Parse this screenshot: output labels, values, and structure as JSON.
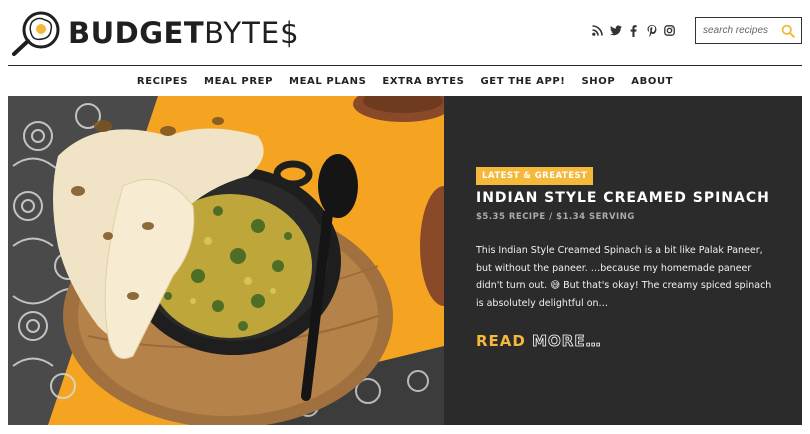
{
  "brand": {
    "logo_bold": "BUDGET",
    "logo_thin": "BYTE$"
  },
  "social_icons": [
    "rss-icon",
    "twitter-icon",
    "facebook-icon",
    "pinterest-icon",
    "instagram-icon"
  ],
  "search": {
    "placeholder": "search recipes"
  },
  "nav": {
    "items": [
      "RECIPES",
      "MEAL PREP",
      "MEAL PLANS",
      "EXTRA BYTES",
      "GET THE APP!",
      "SHOP",
      "ABOUT"
    ]
  },
  "feature": {
    "badge": "LATEST & GREATEST",
    "title": "INDIAN STYLE CREAMED SPINACH",
    "cost": "$5.35 RECIPE / $1.34 SERVING",
    "description": "This Indian Style Creamed Spinach is a bit like Palak Paneer, but without the paneer. …because my homemade paneer didn't turn out. 😅 But that's okay! The creamy spiced spinach is absolutely delightful on…",
    "read_more_1": "READ",
    "read_more_2": "MORE…",
    "image_alt": "Indian style creamed spinach in black bowl with naan bread"
  },
  "colors": {
    "accent": "#f4b93a",
    "panel": "#2b2b2b",
    "image_background": "#f4a421"
  }
}
